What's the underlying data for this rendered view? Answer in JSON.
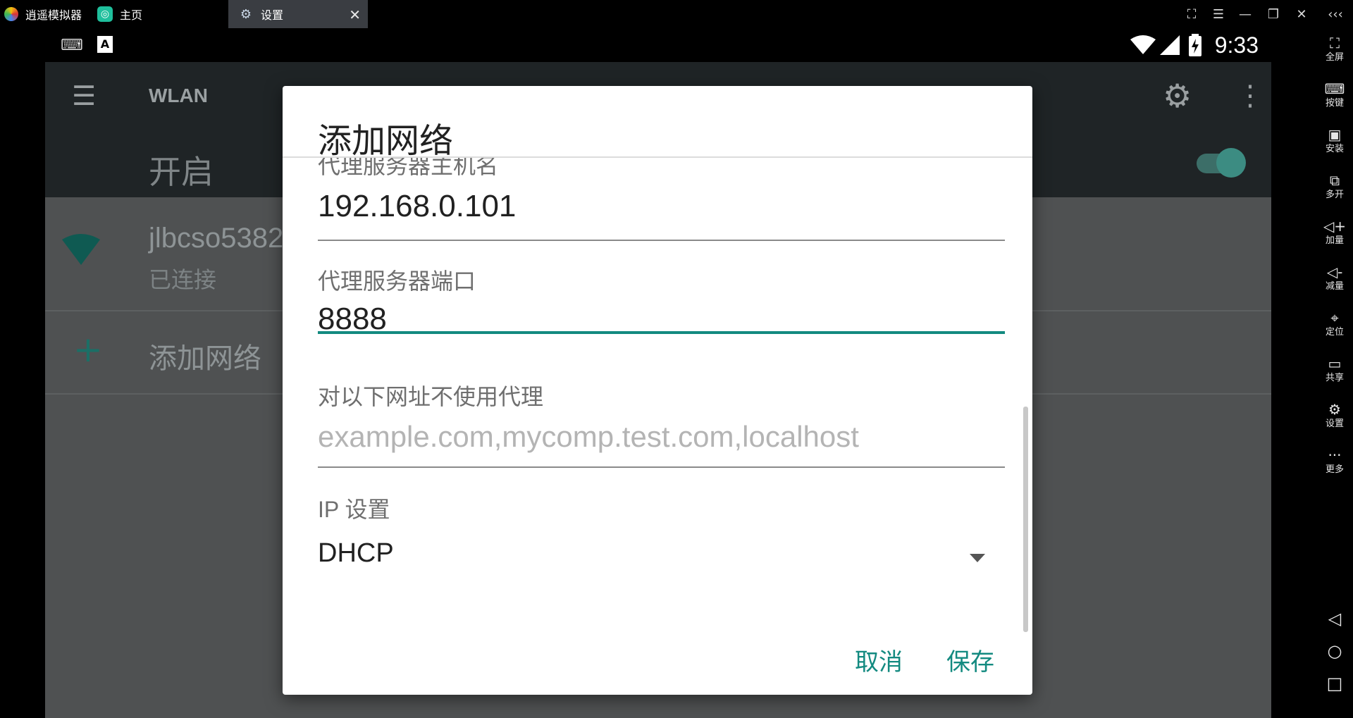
{
  "emulator": {
    "app_name": "逍遥模拟器",
    "tabs": [
      {
        "label": "主页"
      },
      {
        "label": "设置"
      }
    ],
    "sidebar": [
      {
        "label": "全屏",
        "icon": "fullscreen-icon",
        "glyph": "⛶"
      },
      {
        "label": "按键",
        "icon": "keyboard-icon",
        "glyph": "⌨"
      },
      {
        "label": "安装",
        "icon": "apk-install-icon",
        "glyph": "▣"
      },
      {
        "label": "多开",
        "icon": "multi-instance-icon",
        "glyph": "⧉"
      },
      {
        "label": "加量",
        "icon": "volume-up-icon",
        "glyph": "◁+"
      },
      {
        "label": "减量",
        "icon": "volume-down-icon",
        "glyph": "◁-"
      },
      {
        "label": "定位",
        "icon": "location-icon",
        "glyph": "⌖"
      },
      {
        "label": "共享",
        "icon": "folder-icon",
        "glyph": "▭"
      },
      {
        "label": "设置",
        "icon": "gear-icon",
        "glyph": "⚙"
      },
      {
        "label": "更多",
        "icon": "more-icon",
        "glyph": "···"
      }
    ]
  },
  "android": {
    "time": "9:33",
    "appbar_title": "WLAN",
    "switch_label": "开启",
    "network": {
      "ssid": "jlbcso5382",
      "status": "已连接"
    },
    "add_network_label": "添加网络"
  },
  "dialog": {
    "title": "添加网络",
    "proxy_host_label": "代理服务器主机名",
    "proxy_host_value": "192.168.0.101",
    "proxy_port_label": "代理服务器端口",
    "proxy_port_value": "8888",
    "bypass_label": "对以下网址不使用代理",
    "bypass_placeholder": "example.com,mycomp.test.com,localhost",
    "ip_settings_label": "IP 设置",
    "ip_settings_value": "DHCP",
    "cancel": "取消",
    "save": "保存"
  },
  "colors": {
    "accent": "#138a80",
    "switch_on": "#3c8c82"
  }
}
